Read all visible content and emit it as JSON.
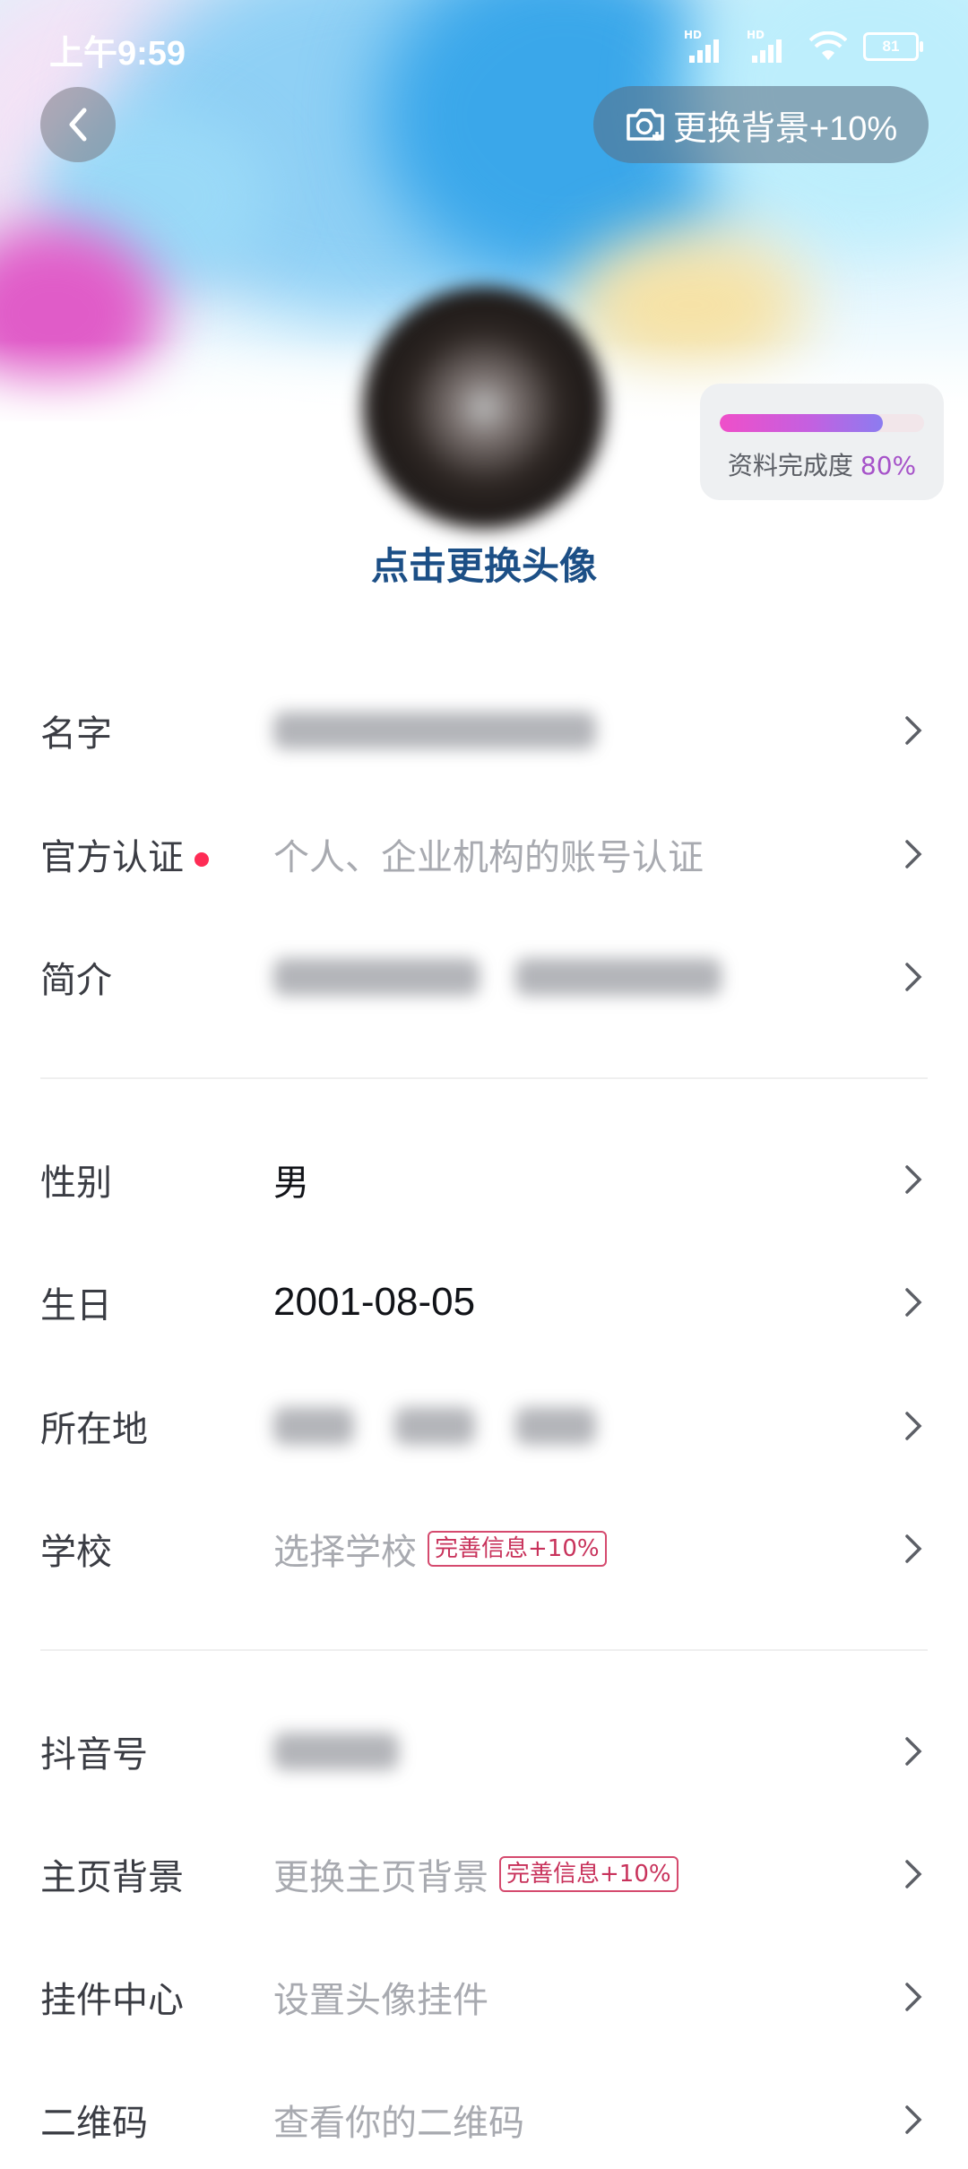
{
  "status_bar": {
    "time": "上午9:59",
    "signal_1_label": "HD",
    "signal_2_label": "HD",
    "battery": "81"
  },
  "header": {
    "back_icon": "chevron-left-icon",
    "change_background_label": "更换背景+10%",
    "change_background_icon": "camera-icon"
  },
  "avatar": {
    "change_label": "点击更换头像"
  },
  "completion": {
    "label": "资料完成度",
    "percent_text": "80%",
    "progress": 0.8
  },
  "rows": [
    {
      "label": "名字",
      "value": "",
      "blurred": true
    },
    {
      "label": "官方认证",
      "value": "个人、企业机构的账号认证",
      "dot": true
    },
    {
      "label": "简介",
      "value": "",
      "blurred": true
    },
    {
      "label": "性别",
      "value": "男"
    },
    {
      "label": "生日",
      "value": "2001-08-05"
    },
    {
      "label": "所在地",
      "value": "",
      "blurred": true
    },
    {
      "label": "学校",
      "value": "选择学校",
      "badge": "完善信息+10%"
    },
    {
      "label": "抖音号",
      "value": "",
      "blurred": true
    },
    {
      "label": "主页背景",
      "value": "更换主页背景",
      "badge": "完善信息+10%"
    },
    {
      "label": "挂件中心",
      "value": "设置头像挂件"
    },
    {
      "label": "二维码",
      "value": "查看你的二维码"
    }
  ],
  "colors": {
    "accent_red": "#fe2c55",
    "avatar_label": "#1c4f86",
    "progress_start": "#ef4fc9",
    "progress_end": "#8c7cf0"
  }
}
